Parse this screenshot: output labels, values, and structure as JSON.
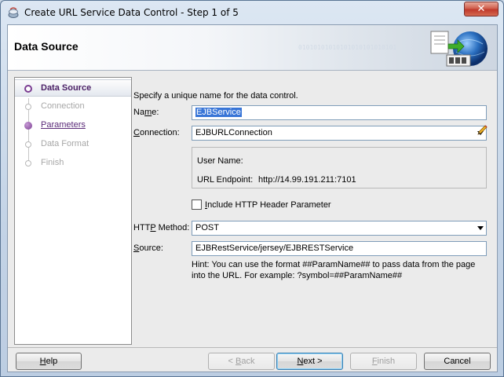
{
  "window": {
    "title": "Create URL Service Data Control  - Step 1 of 5",
    "close_glyph": "✕"
  },
  "header": {
    "title": "Data Source",
    "decor_text": "01010101010101010101010101"
  },
  "nav": {
    "items": [
      {
        "label": "Data Source",
        "state": "current"
      },
      {
        "label": "Connection",
        "state": "disabled"
      },
      {
        "label": "Parameters",
        "state": "link"
      },
      {
        "label": "Data Format",
        "state": "disabled"
      },
      {
        "label": "Finish",
        "state": "disabled"
      }
    ]
  },
  "form": {
    "intro": "Specify a unique name for the data control.",
    "name_label_pre": "Na",
    "name_label_ul": "m",
    "name_label_post": "e:",
    "name_value": "EJBService",
    "connection_label_ul": "C",
    "connection_label_post": "onnection:",
    "connection_value": "EJBURLConnection",
    "user_name_label": "User Name:",
    "url_endpoint_label": "URL Endpoint:",
    "url_endpoint_value": "http://14.99.191.211:7101",
    "include_header_label_ul": "I",
    "include_header_label_post": "nclude HTTP Header Parameter",
    "include_header_checked": false,
    "http_method_label_pre": "HTT",
    "http_method_label_ul": "P",
    "http_method_label_post": " Method:",
    "http_method_value": "POST",
    "source_label_ul": "S",
    "source_label_post": "ource:",
    "source_value": "EJBRestService/jersey/EJBRESTService",
    "hint": "Hint: You can use the format ##ParamName## to pass data from the page into the URL. For example: ?symbol=##ParamName##"
  },
  "buttons": {
    "help_ul": "H",
    "help_post": "elp",
    "back_pre": "< ",
    "back_ul": "B",
    "back_post": "ack",
    "next_ul": "N",
    "next_post": "ext >",
    "finish_ul": "F",
    "finish_post": "inish",
    "cancel": "Cancel"
  },
  "colors": {
    "accent_purple": "#7b3e92",
    "selection_blue": "#3875d7"
  }
}
